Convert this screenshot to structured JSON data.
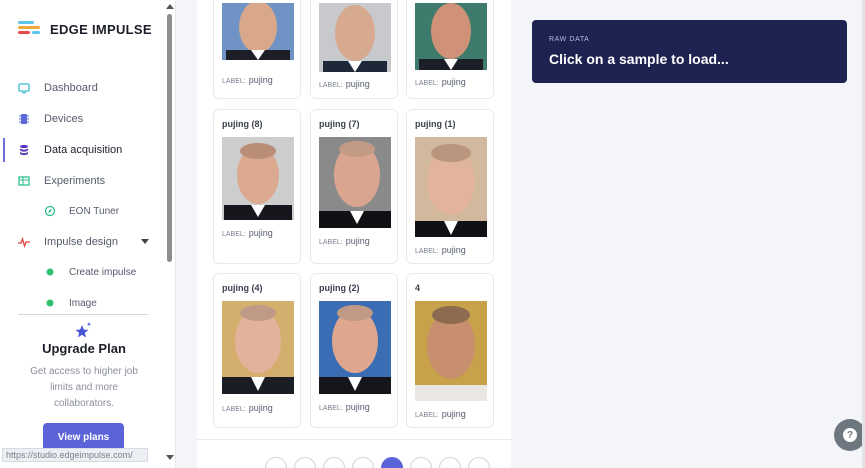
{
  "brand": {
    "name": "EDGE IMPULSE",
    "logo_colors": [
      "#5cc6e8",
      "#f2a93b",
      "#e64b4b"
    ]
  },
  "sidebar": {
    "items": [
      {
        "label": "Dashboard",
        "icon": "monitor-icon",
        "color": "#3cbad1"
      },
      {
        "label": "Devices",
        "icon": "chip-icon",
        "color": "#5b6ad6"
      },
      {
        "label": "Data acquisition",
        "icon": "database-icon",
        "color": "#5b37b5",
        "active": true
      },
      {
        "label": "Experiments",
        "icon": "table-icon",
        "color": "#2fbf8a"
      },
      {
        "label": "EON Tuner",
        "icon": "compass-icon",
        "color": "#2fbf8a",
        "sub": true
      },
      {
        "label": "Impulse design",
        "icon": "pulse-icon",
        "color": "#e8433d"
      },
      {
        "label": "Create impulse",
        "icon": "dot-icon",
        "color": "#2fbf6e",
        "sub": true
      },
      {
        "label": "Image",
        "icon": "dot-icon",
        "color": "#2fbf6e",
        "sub": true
      }
    ],
    "upgrade": {
      "title": "Upgrade Plan",
      "text": "Get access to higher job limits and more collaborators.",
      "button": "View plans"
    },
    "status_url": "https://studio.edgeimpulse.com/"
  },
  "samples": [
    {
      "title": "",
      "label_key": "LABEL:",
      "label": "pujing"
    },
    {
      "title": "",
      "label_key": "LABEL:",
      "label": "pujing"
    },
    {
      "title": "",
      "label_key": "LABEL:",
      "label": "pujing"
    },
    {
      "title": "pujing (8)",
      "label_key": "LABEL:",
      "label": "pujing"
    },
    {
      "title": "pujing (7)",
      "label_key": "LABEL:",
      "label": "pujing"
    },
    {
      "title": "pujing (1)",
      "label_key": "LABEL:",
      "label": "pujing"
    },
    {
      "title": "pujing (4)",
      "label_key": "LABEL:",
      "label": "pujing"
    },
    {
      "title": "pujing (2)",
      "label_key": "LABEL:",
      "label": "pujing"
    },
    {
      "title": "4",
      "label_key": "LABEL:",
      "label": "pujing"
    }
  ],
  "raw_data": {
    "caption": "RAW DATA",
    "message": "Click on a sample to load..."
  },
  "help": {
    "label": "?"
  }
}
